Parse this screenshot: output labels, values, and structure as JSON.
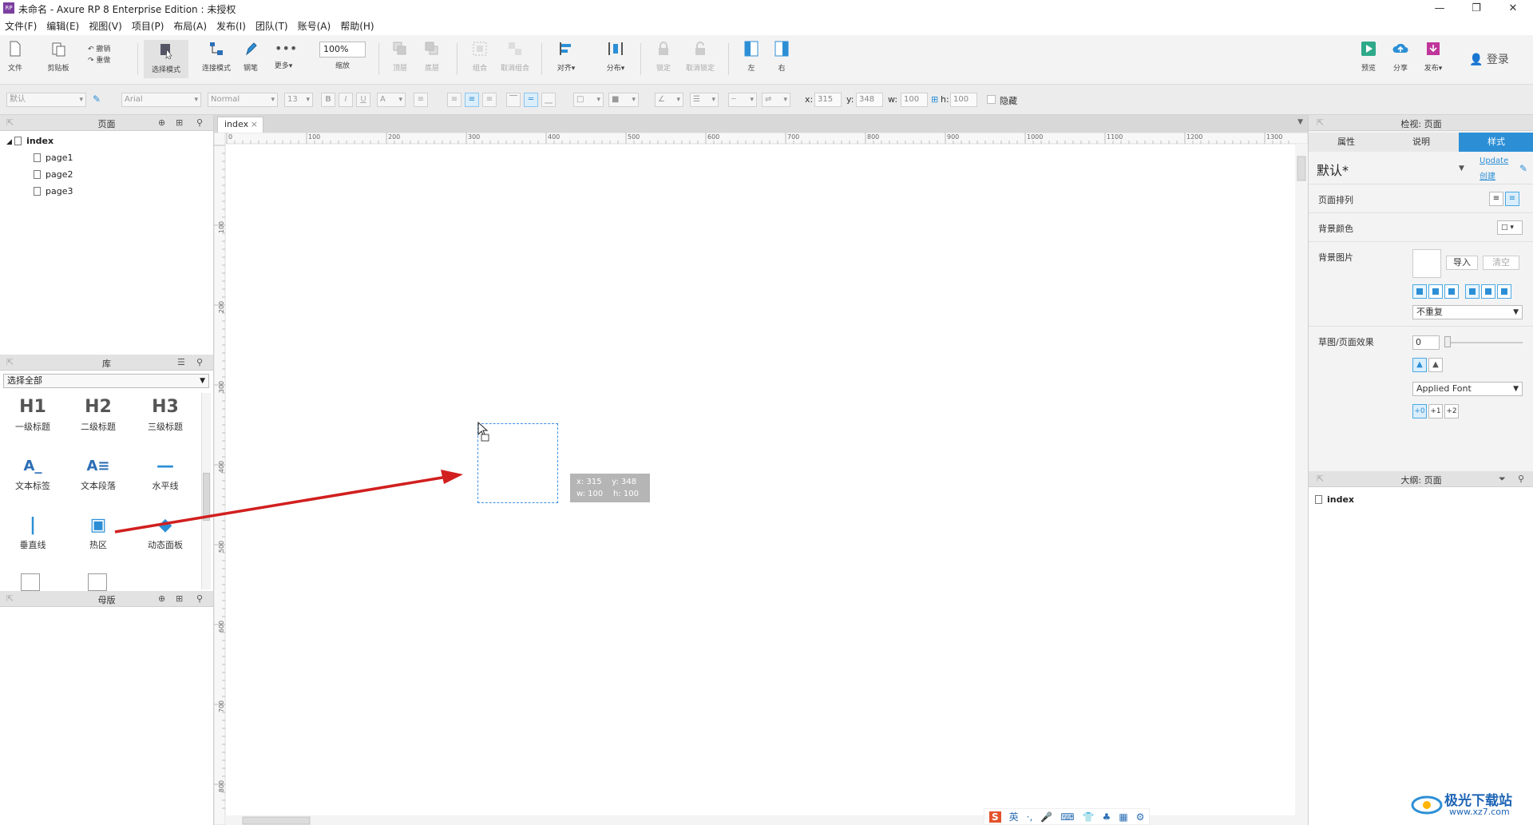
{
  "window": {
    "logo_text": "RP",
    "title": "未命名 - Axure RP 8 Enterprise Edition : 未授权",
    "minimize": "—",
    "maximize": "❐",
    "close": "✕"
  },
  "menu": [
    "文件(F)",
    "编辑(E)",
    "视图(V)",
    "项目(P)",
    "布局(A)",
    "发布(I)",
    "团队(T)",
    "账号(A)",
    "帮助(H)"
  ],
  "toolbar": {
    "file": "文件",
    "clipboard": "剪贴板",
    "undo": "撤销",
    "redo": "重做",
    "select_mode": "选择模式",
    "connect_mode": "连接模式",
    "pen": "钢笔",
    "more": "更多▾",
    "zoom_value": "100%",
    "zoom_label": "缩放",
    "top": "顶层",
    "bottom": "底层",
    "group": "组合",
    "ungroup": "取消组合",
    "align": "对齐▾",
    "distribute": "分布▾",
    "lock": "锁定",
    "unlock": "取消锁定",
    "left": "左",
    "right": "右",
    "preview": "预览",
    "share": "分享",
    "publish": "发布▾",
    "login": "登录"
  },
  "formatbar": {
    "style": "默认",
    "font": "Arial",
    "weight": "Normal",
    "size": "13",
    "bold": "B",
    "italic": "I",
    "underline": "U",
    "font_color": "A",
    "x_label": "x:",
    "x": "315",
    "y_label": "y:",
    "y": "348",
    "w_label": "w:",
    "w": "100",
    "h_label": "h:",
    "h": "100",
    "hidden": "隐藏"
  },
  "pages_panel": {
    "title": "页面",
    "root": "index",
    "children": [
      "page1",
      "page2",
      "page3"
    ]
  },
  "library_panel": {
    "title": "库",
    "filter": "选择全部",
    "items": [
      {
        "glyph": "H1",
        "label": "一级标题"
      },
      {
        "glyph": "H2",
        "label": "二级标题"
      },
      {
        "glyph": "H3",
        "label": "三级标题"
      },
      {
        "glyph": "A_",
        "label": "文本标签"
      },
      {
        "glyph": "A≡",
        "label": "文本段落"
      },
      {
        "glyph": "—",
        "label": "水平线"
      },
      {
        "glyph": "|",
        "label": "垂直线"
      },
      {
        "glyph": "▣",
        "label": "热区"
      },
      {
        "glyph": "◆",
        "label": "动态面板"
      }
    ]
  },
  "masters_panel": {
    "title": "母版"
  },
  "canvas": {
    "tab": "index",
    "tab_close": "×",
    "ruler_h": [
      "0",
      "100",
      "200",
      "300",
      "400",
      "500",
      "600",
      "700",
      "800",
      "900",
      "1000",
      "1100",
      "1200",
      "1300"
    ],
    "ruler_v": [
      "100",
      "200",
      "300",
      "400",
      "500",
      "600",
      "700",
      "800"
    ],
    "tooltip_line1": "x: 315    y: 348",
    "tooltip_line2": "w: 100    h: 100"
  },
  "inspector": {
    "title": "检视: 页面",
    "tabs": [
      "属性",
      "说明",
      "样式"
    ],
    "style_name": "默认*",
    "update": "Update",
    "create": "创建",
    "page_align": "页面排列",
    "bg_color": "背景颜色",
    "bg_image": "背景图片",
    "import": "导入",
    "clear": "清空",
    "repeat": "不重复",
    "sketch": "草图/页面效果",
    "sketch_value": "0",
    "font": "Applied Font",
    "font_steps": [
      "+0",
      "+1",
      "+2"
    ]
  },
  "outline": {
    "title": "大纲: 页面",
    "item": "index"
  },
  "ime": [
    "英",
    "·,",
    "🎤",
    "⌨",
    "👕",
    "♣",
    "▦",
    "⚙"
  ],
  "watermark": {
    "name": "极光下载站",
    "url": "www.xz7.com"
  },
  "colors": {
    "accent": "#2c8fd6",
    "arrow": "#d11f1f",
    "selection": "#3a8ee6"
  }
}
